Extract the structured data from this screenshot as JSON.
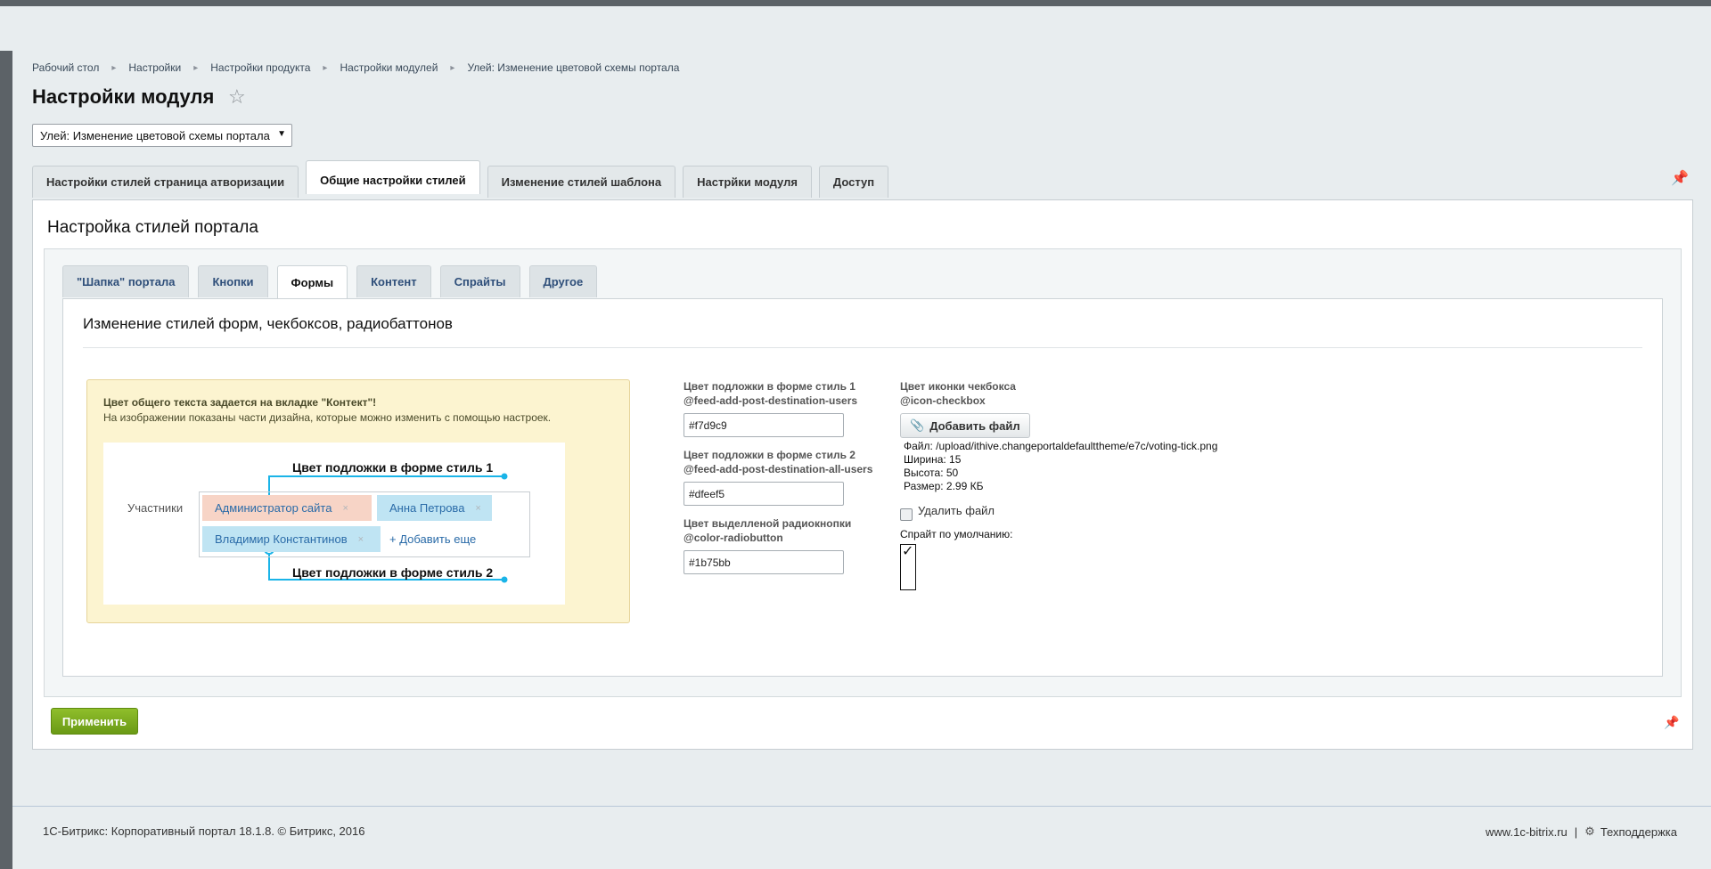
{
  "breadcrumb": [
    "Рабочий стол",
    "Настройки",
    "Настройки продукта",
    "Настройки модулей",
    "Улей: Изменение цветовой схемы портала"
  ],
  "page": {
    "title": "Настройки модуля"
  },
  "module_select": {
    "value": "Улей: Изменение цветовой схемы портала"
  },
  "main_tabs": [
    "Настройки стилей страница атворизации",
    "Общие настройки стилей",
    "Изменение стилей шаблона",
    "Настрйки модуля",
    "Доступ"
  ],
  "panel": {
    "title": "Настройка стилей портала"
  },
  "sub_tabs": [
    "\"Шапка\" портала",
    "Кнопки",
    "Формы",
    "Контент",
    "Спрайты",
    "Другое"
  ],
  "content": {
    "title": "Изменение стилей форм, чекбоксов, радиобаттонов"
  },
  "info": {
    "bold": "Цвет общего текста задается на вкладке \"Контект\"!",
    "text": "На изображении показаны части дизайна, которые можно изменить с помощью настроек.",
    "demo": {
      "label_top": "Цвет подложки в форме стиль 1",
      "label_bottom": "Цвет подложки в форме стиль 2",
      "participants": "Участники",
      "chip_admin": "Администратор сайта",
      "chip_anna": "Анна Петрова",
      "chip_vlad": "Владимир Константинов",
      "chip_close": "×",
      "add_more": "+ Добавить еще",
      "line_color": "#1ab4e8"
    }
  },
  "fields": [
    {
      "label": "Цвет подложки в форме стиль 1",
      "var": "@feed-add-post-destination-users",
      "value": "#f7d9c9"
    },
    {
      "label": "Цвет подложки в форме стиль 2",
      "var": "@feed-add-post-destination-all-users",
      "value": "#dfeef5"
    },
    {
      "label": "Цвет выделленой радиокнопки",
      "var": "@color-radiobutton",
      "value": "#1b75bb"
    }
  ],
  "checkbox_icon": {
    "label": "Цвет иконки чекбокса",
    "var": "@icon-checkbox",
    "add_file_label": "Добавить файл",
    "file_path": "Файл: /upload/ithive.changeportaldefaulttheme/e7c/voting-tick.png",
    "width": "Ширина: 15",
    "height": "Высота: 50",
    "size": "Размер: 2.99 КБ",
    "delete_label": "Удалить файл",
    "default_sprite_label": "Спрайт по умолчанию:",
    "tick": "✓"
  },
  "apply_button": "Применить",
  "footer": {
    "left": "1С-Битрикс: Корпоративный портал 18.1.8. © Битрикс, 2016",
    "site": "www.1c-bitrix.ru",
    "separator": "|",
    "support": "Техподдержка"
  }
}
